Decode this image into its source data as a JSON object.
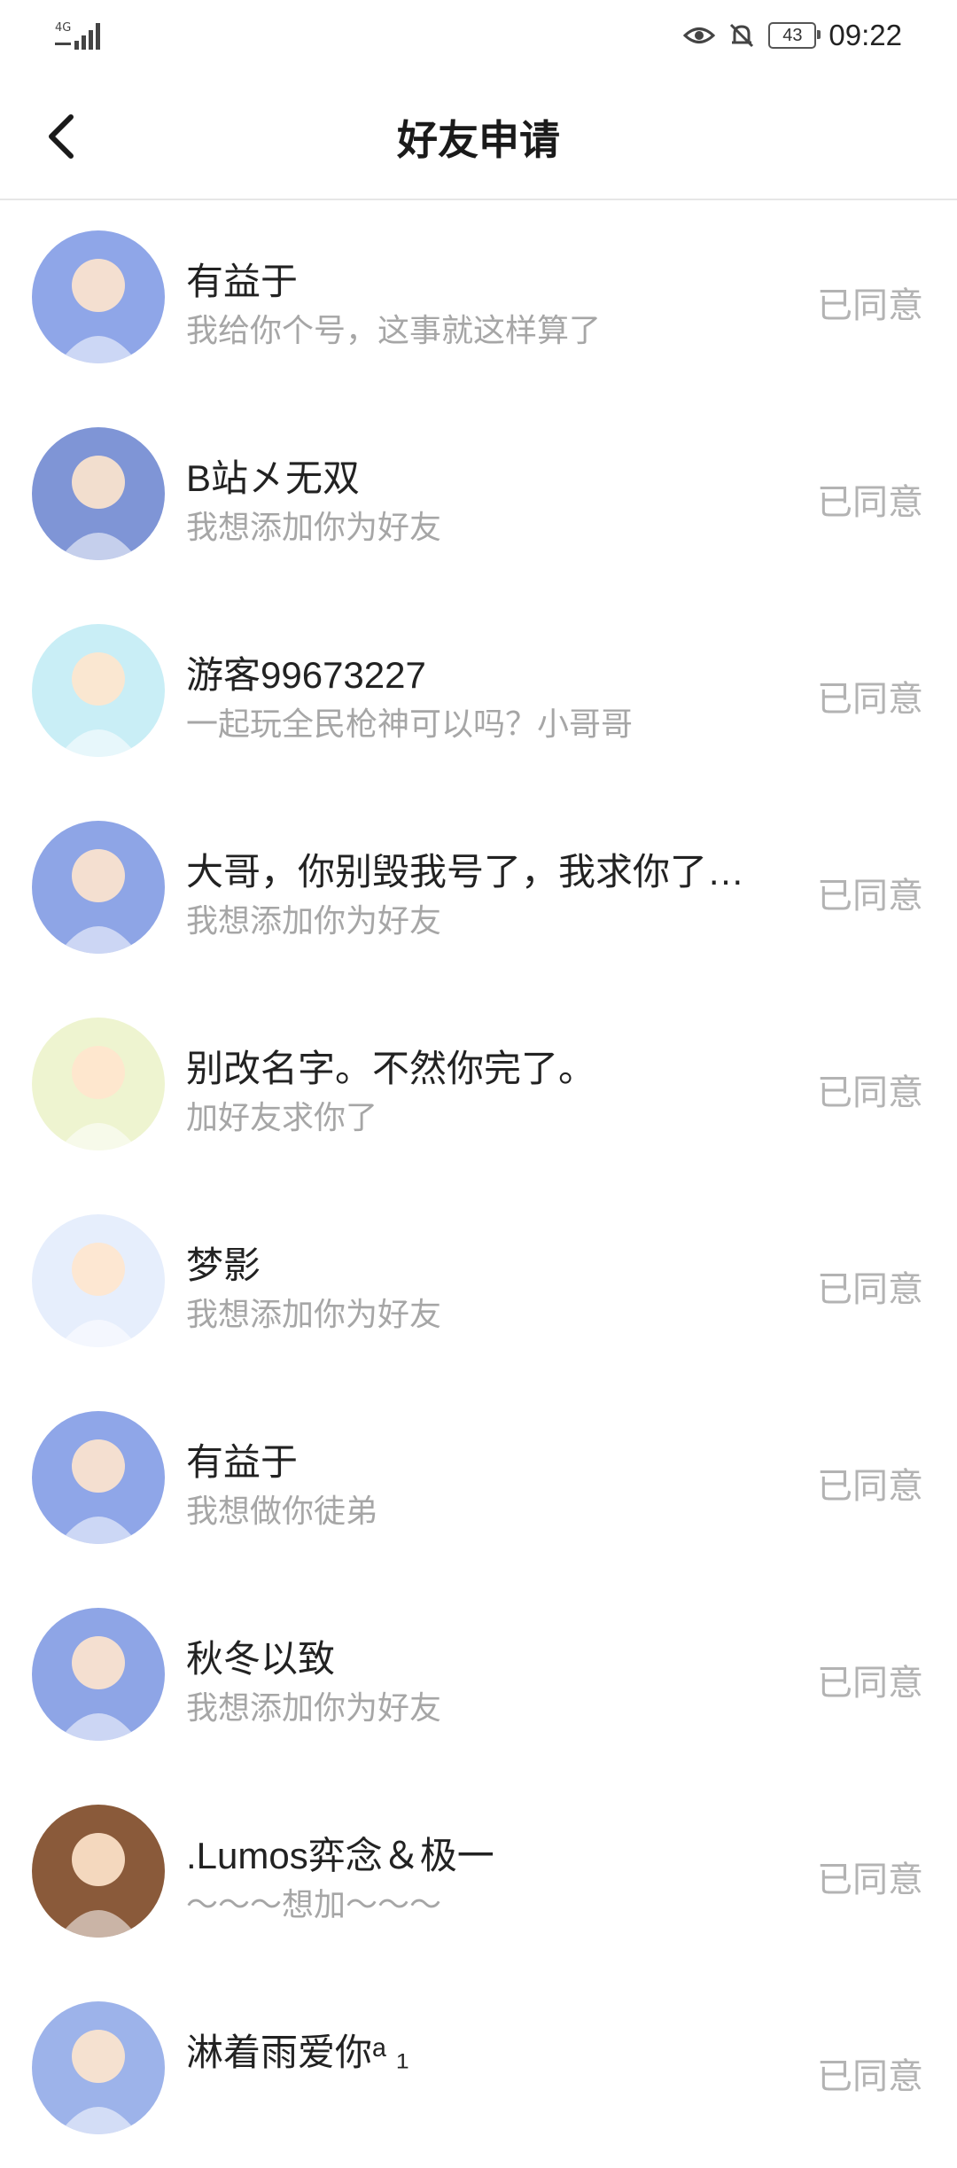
{
  "status_bar": {
    "network": "4G",
    "battery": "43",
    "time": "09:22",
    "icons": [
      "eye-icon",
      "bell-off-icon"
    ]
  },
  "header": {
    "title": "好友申请",
    "back_icon": "chevron-left-icon"
  },
  "requests": [
    {
      "name": "有益于",
      "message": "我给你个号，这事就这样算了",
      "status": "已同意",
      "avatar": "purple-hair-avatar",
      "avatar_color": "#8fa6e8"
    },
    {
      "name": "B站㐅无双",
      "message": "我想添加你为好友",
      "status": "已同意",
      "avatar": "dark-hair-girl-avatar",
      "avatar_color": "#7f95d6"
    },
    {
      "name": "游客99673227",
      "message": "一起玩全民枪神可以吗？小哥哥",
      "status": "已同意",
      "avatar": "default-user-avatar",
      "avatar_color": "#c9eef6"
    },
    {
      "name": "大哥，你别毁我号了，我求你了…",
      "message": "我想添加你为好友",
      "status": "已同意",
      "avatar": "brown-hair-boy-avatar",
      "avatar_color": "#8ea5e6"
    },
    {
      "name": "别改名字。不然你完了。",
      "message": "加好友求你了",
      "status": "已同意",
      "avatar": "anime-girl-avatar",
      "avatar_color": "#eef4d0"
    },
    {
      "name": "梦影",
      "message": "我想添加你为好友",
      "status": "已同意",
      "avatar": "robot-girl-avatar",
      "avatar_color": "#e6eefc"
    },
    {
      "name": "有益于",
      "message": "我想做你徒弟",
      "status": "已同意",
      "avatar": "purple-hair-avatar",
      "avatar_color": "#8fa6e8"
    },
    {
      "name": "秋冬以致",
      "message": "我想添加你为好友",
      "status": "已同意",
      "avatar": "brown-hair-boy-avatar",
      "avatar_color": "#8ea5e6"
    },
    {
      "name": ".Lumos弈念＆极一",
      "message": "～～～想加～～～",
      "status": "已同意",
      "avatar": "photo-girl-avatar",
      "avatar_color": "#8a5a3a"
    },
    {
      "name": "淋着雨爱你ᵃ ₁",
      "message": "",
      "status": "已同意",
      "avatar": "white-hair-avatar",
      "avatar_color": "#9db3ea"
    }
  ]
}
